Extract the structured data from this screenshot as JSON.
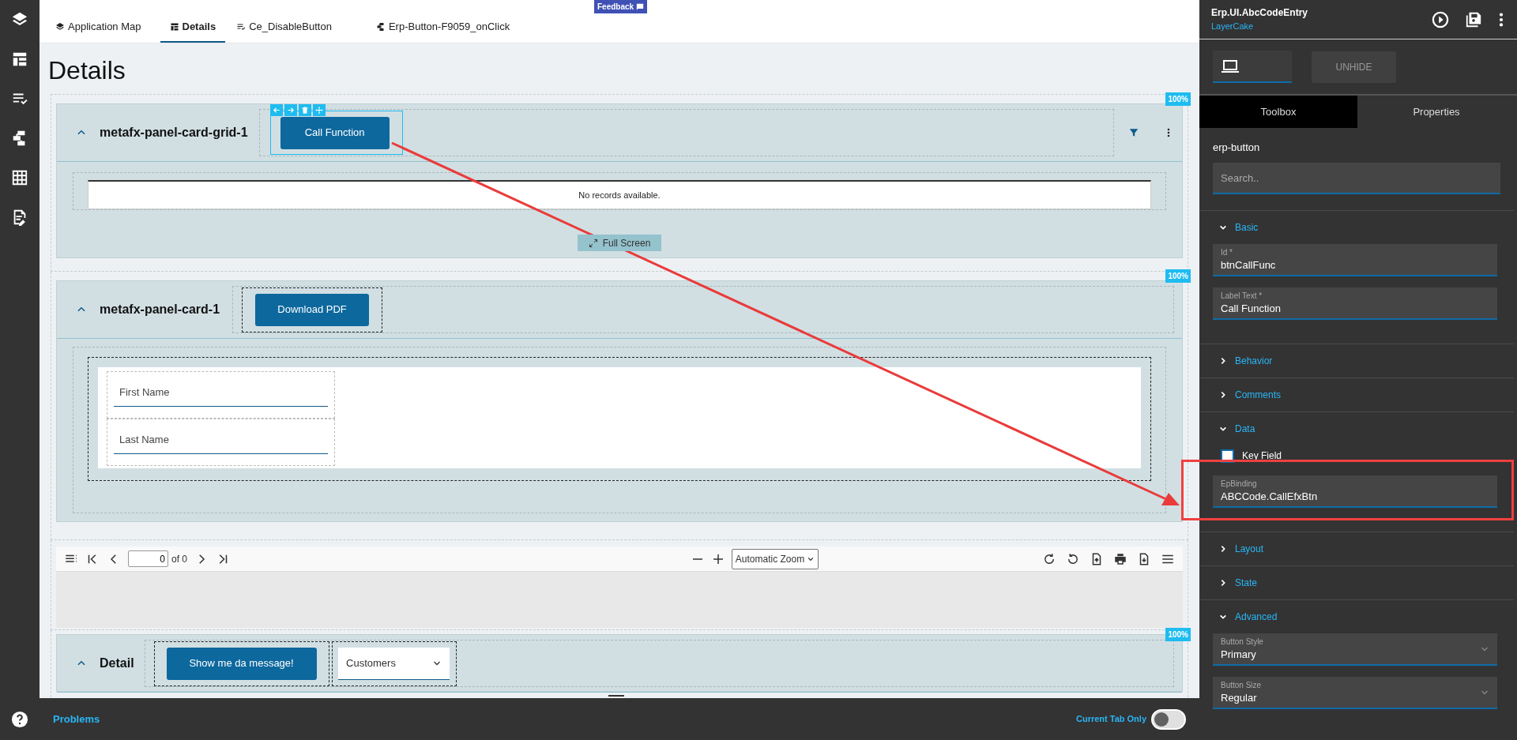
{
  "feedback": {
    "label": "Feedback"
  },
  "tabs": [
    {
      "label": "Application Map",
      "kind": "layers",
      "selected": false
    },
    {
      "label": "Details",
      "kind": "layout",
      "selected": true
    },
    {
      "label": "Ce_DisableButton",
      "kind": "checklist",
      "selected": false
    },
    {
      "label": "Erp-Button-F9059_onClick",
      "kind": "tree",
      "selected": false
    }
  ],
  "page_title": "Details",
  "sections": [
    {
      "kind": "grid-card",
      "badge": "100%",
      "title": "metafx-panel-card-grid-1",
      "expanded": true,
      "button": "Call Function",
      "empty_text": "No records available.",
      "full_screen": "Full Screen"
    },
    {
      "kind": "form-card",
      "badge": "100%",
      "title": "metafx-panel-card-1",
      "expanded": true,
      "button": "Download PDF",
      "fields": [
        {
          "placeholder": "First Name"
        },
        {
          "placeholder": "Last Name"
        }
      ]
    },
    {
      "kind": "pdf-viewer",
      "page": "0",
      "page_count": "of 0",
      "zoom": "Automatic Zoom"
    },
    {
      "kind": "detail-card",
      "badge": "100%",
      "title": "Detail",
      "expanded": true,
      "button": "Show me da message!",
      "dropdown": "Customers"
    }
  ],
  "bottom_bar": {
    "problems": "Problems",
    "toggle_label": "Current Tab Only",
    "toggle_on": false
  },
  "panel": {
    "title": "Erp.UI.AbcCodeEntry",
    "subtitle": "LayerCake",
    "unhide": "UNHIDE",
    "tabs": [
      {
        "label": "Toolbox",
        "selected": true
      },
      {
        "label": "Properties",
        "selected": false
      }
    ],
    "component": "erp-button",
    "search_placeholder": "Search..",
    "groups": [
      {
        "label": "Basic",
        "expanded": true,
        "items": [
          {
            "kind": "text",
            "label": "Id *",
            "value": "btnCallFunc",
            "highlighted": false
          },
          {
            "kind": "text",
            "label": "Label Text *",
            "value": "Call Function",
            "highlighted": false
          }
        ]
      },
      {
        "label": "Behavior",
        "expanded": false
      },
      {
        "label": "Comments",
        "expanded": false
      },
      {
        "label": "Data",
        "expanded": true,
        "items": [
          {
            "kind": "checkbox",
            "label": "Key Field",
            "checked": false
          },
          {
            "kind": "text",
            "label": "EpBinding",
            "value": "ABCCode.CallEfxBtn",
            "highlighted": true
          }
        ]
      },
      {
        "label": "Layout",
        "expanded": false
      },
      {
        "label": "State",
        "expanded": false
      },
      {
        "label": "Advanced",
        "expanded": true,
        "items": [
          {
            "kind": "select",
            "label": "Button Style",
            "value": "Primary",
            "highlighted": false
          },
          {
            "kind": "select",
            "label": "Button Size",
            "value": "Regular",
            "highlighted": false
          }
        ]
      }
    ]
  }
}
